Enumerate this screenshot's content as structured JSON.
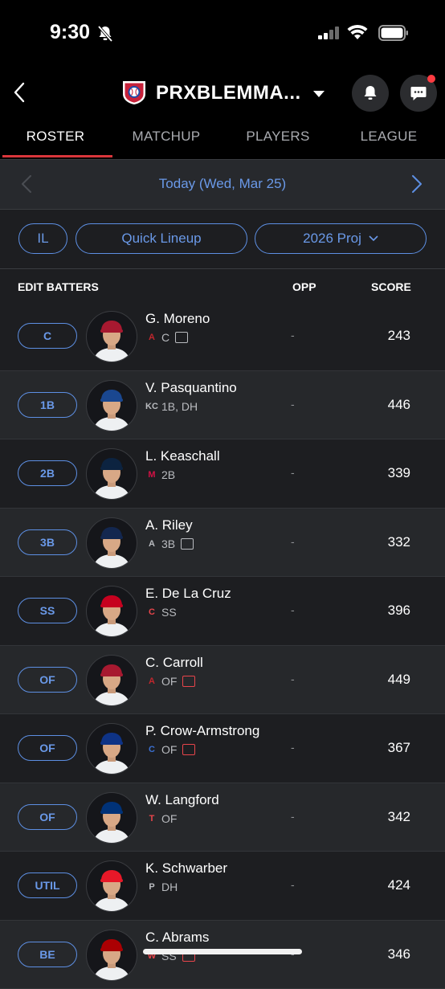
{
  "status_bar": {
    "time": "9:30"
  },
  "header": {
    "team_name": "PRXBLEMMA..."
  },
  "tabs": [
    "ROSTER",
    "MATCHUP",
    "PLAYERS",
    "LEAGUE"
  ],
  "date_nav": {
    "label": "Today (Wed, Mar 25)"
  },
  "filters": {
    "il": "IL",
    "quick_lineup": "Quick Lineup",
    "projection": "2026 Proj"
  },
  "columns": {
    "edit": "EDIT BATTERS",
    "opp": "OPP",
    "score": "SCORE"
  },
  "players": [
    {
      "pos": "C",
      "name": "G. Moreno",
      "team_logo": "A",
      "team_color": "#c0272d",
      "elig": "C",
      "news": "grey",
      "opp": "-",
      "score": "243",
      "cap": "#a71930"
    },
    {
      "pos": "1B",
      "name": "V. Pasquantino",
      "team_logo": "KC",
      "team_color": "#b9bbbf",
      "elig": "1B, DH",
      "news": "",
      "opp": "-",
      "score": "446",
      "cap": "#1a4790"
    },
    {
      "pos": "2B",
      "name": "L. Keaschall",
      "team_logo": "M",
      "team_color": "#d31145",
      "elig": "2B",
      "news": "",
      "opp": "-",
      "score": "339",
      "cap": "#0c2340"
    },
    {
      "pos": "3B",
      "name": "A. Riley",
      "team_logo": "A",
      "team_color": "#b9bbbf",
      "elig": "3B",
      "news": "grey",
      "opp": "-",
      "score": "332",
      "cap": "#13274f"
    },
    {
      "pos": "SS",
      "name": "E. De La Cruz",
      "team_logo": "C",
      "team_color": "#e8454b",
      "elig": "SS",
      "news": "",
      "opp": "-",
      "score": "396",
      "cap": "#c6011f"
    },
    {
      "pos": "OF",
      "name": "C. Carroll",
      "team_logo": "A",
      "team_color": "#c0272d",
      "elig": "OF",
      "news": "red",
      "opp": "-",
      "score": "449",
      "cap": "#a71930"
    },
    {
      "pos": "OF",
      "name": "P. Crow-Armstrong",
      "team_logo": "C",
      "team_color": "#3b6fd1",
      "elig": "OF",
      "news": "red",
      "opp": "-",
      "score": "367",
      "cap": "#0e3386"
    },
    {
      "pos": "OF",
      "name": "W. Langford",
      "team_logo": "T",
      "team_color": "#e8454b",
      "elig": "OF",
      "news": "",
      "opp": "-",
      "score": "342",
      "cap": "#003278"
    },
    {
      "pos": "UTIL",
      "name": "K. Schwarber",
      "team_logo": "P",
      "team_color": "#b9bbbf",
      "elig": "DH",
      "news": "",
      "opp": "-",
      "score": "424",
      "cap": "#e81828"
    },
    {
      "pos": "BE",
      "name": "C. Abrams",
      "team_logo": "W",
      "team_color": "#e8454b",
      "elig": "SS",
      "news": "red",
      "opp": "-",
      "score": "346",
      "cap": "#ab0003"
    }
  ]
}
